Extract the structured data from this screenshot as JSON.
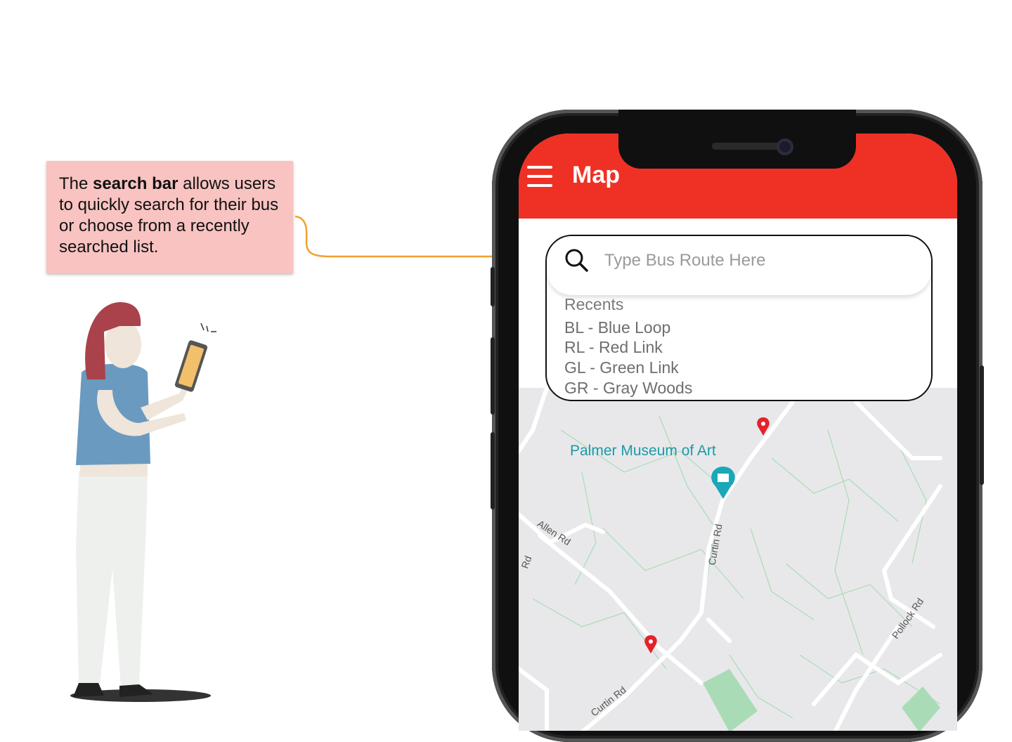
{
  "callout": {
    "prefix": "The ",
    "bold": "search bar",
    "suffix": " allows users to quickly search for their bus or choose from a recently searched list."
  },
  "app": {
    "title": "Map"
  },
  "search": {
    "placeholder": "Type Bus Route Here",
    "value": ""
  },
  "recents": {
    "title": "Recents",
    "items": [
      {
        "label": "BL - Blue Loop"
      },
      {
        "label": "RL - Red Link"
      },
      {
        "label": "GL - Green Link"
      },
      {
        "label": "GR - Gray Woods"
      }
    ]
  },
  "map": {
    "poi": "Palmer Museum of Art",
    "streets": [
      "Allen Rd",
      "Curtin Rd",
      "Pollock Rd",
      "Curtin Rd",
      "Rd"
    ],
    "colors": {
      "header": "#ef3125",
      "pin": "#e3222a",
      "poi": "#1aa8b8",
      "green": "#a9dcb6"
    }
  }
}
